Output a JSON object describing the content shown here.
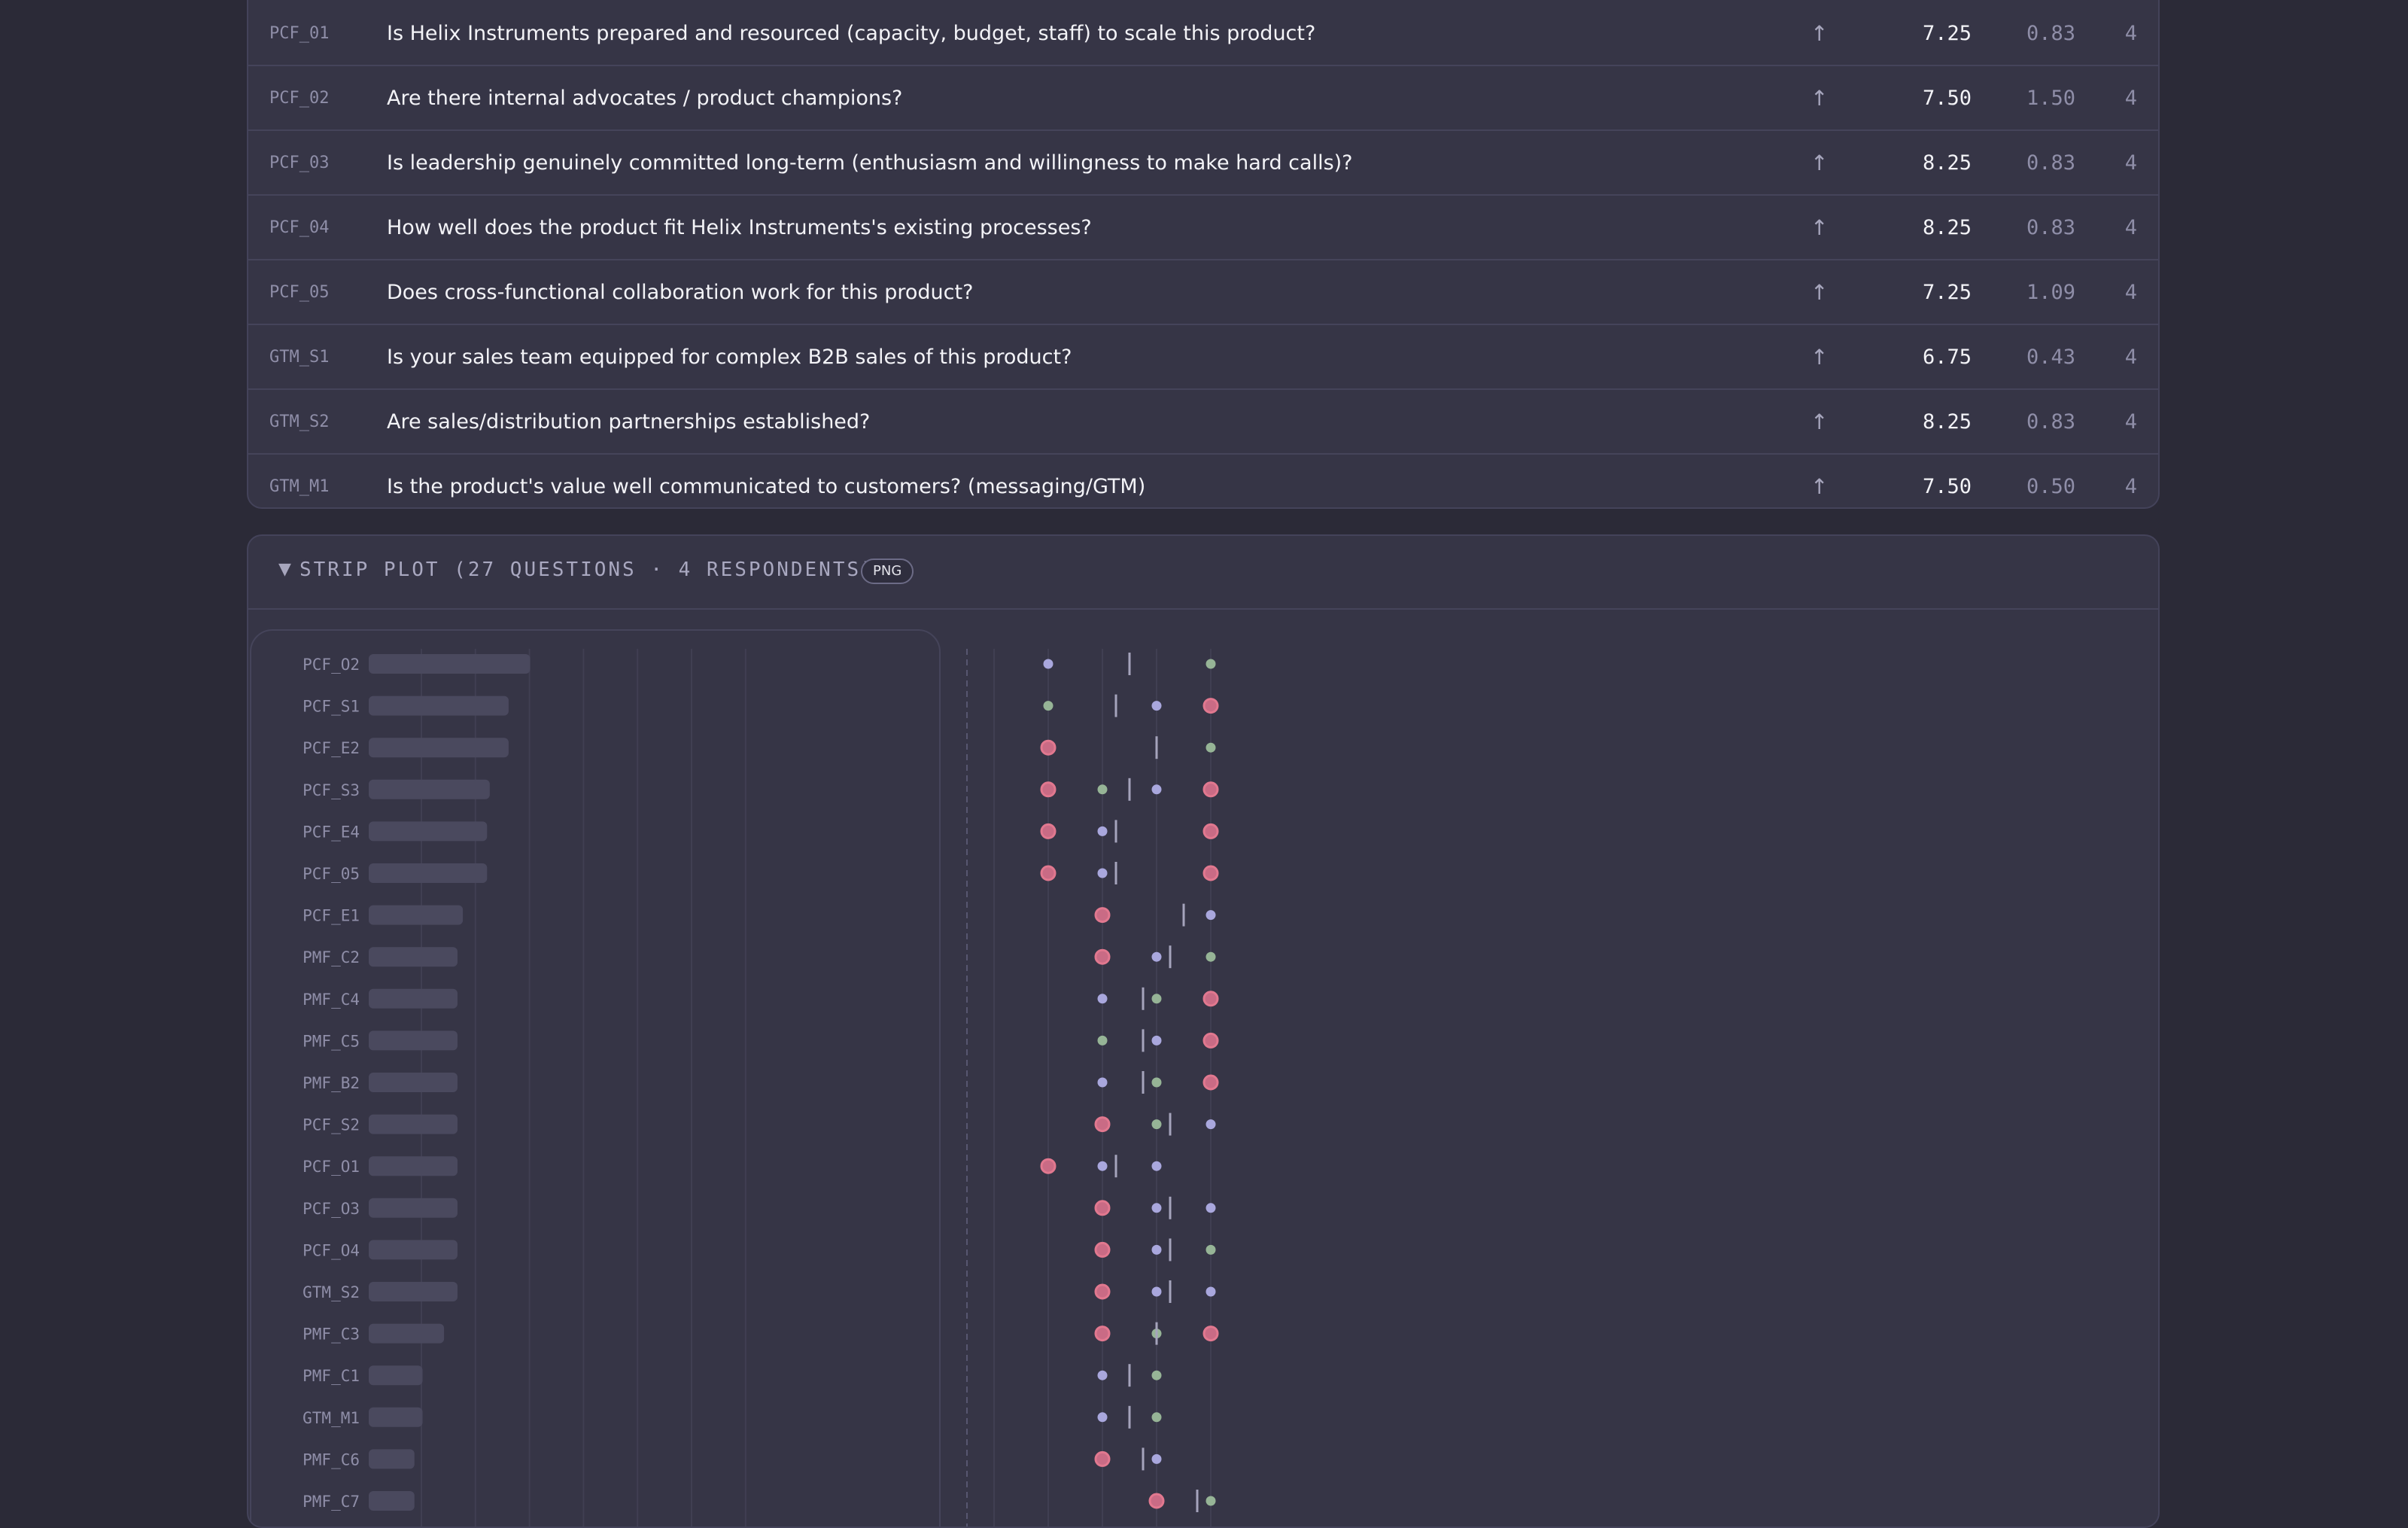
{
  "questions_table": {
    "rows": [
      {
        "id": "PCF_01",
        "text": "Is Helix Instruments prepared and resourced (capacity, budget, staff) to scale this product?",
        "direction": "↑",
        "mean": "7.25",
        "sd": "0.83",
        "n": "4"
      },
      {
        "id": "PCF_02",
        "text": "Are there internal advocates / product champions?",
        "direction": "↑",
        "mean": "7.50",
        "sd": "1.50",
        "n": "4"
      },
      {
        "id": "PCF_03",
        "text": "Is leadership genuinely committed long-term (enthusiasm and willingness to make hard calls)?",
        "direction": "↑",
        "mean": "8.25",
        "sd": "0.83",
        "n": "4"
      },
      {
        "id": "PCF_04",
        "text": "How well does the product fit Helix Instruments's existing processes?",
        "direction": "↑",
        "mean": "8.25",
        "sd": "0.83",
        "n": "4"
      },
      {
        "id": "PCF_05",
        "text": "Does cross-functional collaboration work for this product?",
        "direction": "↑",
        "mean": "7.25",
        "sd": "1.09",
        "n": "4"
      },
      {
        "id": "GTM_S1",
        "text": "Is your sales team equipped for complex B2B sales of this product?",
        "direction": "↑",
        "mean": "6.75",
        "sd": "0.43",
        "n": "4"
      },
      {
        "id": "GTM_S2",
        "text": "Are sales/distribution partnerships established?",
        "direction": "↑",
        "mean": "8.25",
        "sd": "0.83",
        "n": "4"
      },
      {
        "id": "GTM_M1",
        "text": "Is the product's value well communicated to customers? (messaging/GTM)",
        "direction": "↑",
        "mean": "7.50",
        "sd": "0.50",
        "n": "4"
      }
    ]
  },
  "strip_plot": {
    "toggle_icon": "triangle-down-icon",
    "title": "STRIP PLOT (27 QUESTIONS · 4 RESPONDENTS)",
    "png_button": "PNG"
  },
  "colors": {
    "lavender": "#a9a7dd",
    "green": "#96b496",
    "pink_fill": "#c96b85",
    "pink_ring": "#e1788f",
    "bar": "#4a495e",
    "mean_tick": "#a5a4bc"
  },
  "chart_data": {
    "type": "scatter",
    "x_range": [
      1,
      10
    ],
    "rows": [
      {
        "label": "PCF_O2",
        "spread": 3.0,
        "mean": 7.5,
        "points": [
          {
            "v": 6,
            "c": "lavender"
          },
          {
            "v": 9,
            "c": "green"
          }
        ]
      },
      {
        "label": "PCF_S1",
        "spread": 2.6,
        "mean": 7.25,
        "points": [
          {
            "v": 6,
            "c": "green"
          },
          {
            "v": 8,
            "c": "lavender"
          },
          {
            "v": 9,
            "c": "pink"
          }
        ]
      },
      {
        "label": "PCF_E2",
        "spread": 2.6,
        "mean": 8.0,
        "points": [
          {
            "v": 6,
            "c": "pink"
          },
          {
            "v": 9,
            "c": "green"
          }
        ]
      },
      {
        "label": "PCF_S3",
        "spread": 2.25,
        "mean": 7.5,
        "points": [
          {
            "v": 6,
            "c": "pink"
          },
          {
            "v": 7,
            "c": "green"
          },
          {
            "v": 8,
            "c": "lavender"
          },
          {
            "v": 9,
            "c": "pink"
          }
        ]
      },
      {
        "label": "PCF_E4",
        "spread": 2.2,
        "mean": 7.25,
        "points": [
          {
            "v": 6,
            "c": "pink"
          },
          {
            "v": 7,
            "c": "lavender"
          },
          {
            "v": 9,
            "c": "pink"
          }
        ]
      },
      {
        "label": "PCF_05",
        "spread": 2.2,
        "mean": 7.25,
        "points": [
          {
            "v": 6,
            "c": "pink"
          },
          {
            "v": 7,
            "c": "lavender"
          },
          {
            "v": 9,
            "c": "pink"
          }
        ]
      },
      {
        "label": "PCF_E1",
        "spread": 1.75,
        "mean": 8.5,
        "points": [
          {
            "v": 7,
            "c": "pink"
          },
          {
            "v": 9,
            "c": "lavender"
          }
        ]
      },
      {
        "label": "PMF_C2",
        "spread": 1.65,
        "mean": 8.25,
        "points": [
          {
            "v": 7,
            "c": "pink"
          },
          {
            "v": 8,
            "c": "lavender"
          },
          {
            "v": 9,
            "c": "green"
          }
        ]
      },
      {
        "label": "PMF_C4",
        "spread": 1.65,
        "mean": 7.75,
        "points": [
          {
            "v": 7,
            "c": "lavender"
          },
          {
            "v": 8,
            "c": "green"
          },
          {
            "v": 9,
            "c": "pink"
          }
        ]
      },
      {
        "label": "PMF_C5",
        "spread": 1.65,
        "mean": 7.75,
        "points": [
          {
            "v": 7,
            "c": "green"
          },
          {
            "v": 8,
            "c": "lavender"
          },
          {
            "v": 9,
            "c": "pink"
          }
        ]
      },
      {
        "label": "PMF_B2",
        "spread": 1.65,
        "mean": 7.75,
        "points": [
          {
            "v": 7,
            "c": "lavender"
          },
          {
            "v": 8,
            "c": "green"
          },
          {
            "v": 9,
            "c": "pink"
          }
        ]
      },
      {
        "label": "PCF_S2",
        "spread": 1.65,
        "mean": 8.25,
        "points": [
          {
            "v": 7,
            "c": "pink"
          },
          {
            "v": 8,
            "c": "green"
          },
          {
            "v": 9,
            "c": "lavender"
          }
        ]
      },
      {
        "label": "PCF_O1",
        "spread": 1.65,
        "mean": 7.25,
        "points": [
          {
            "v": 6,
            "c": "pink"
          },
          {
            "v": 7,
            "c": "lavender"
          },
          {
            "v": 8,
            "c": "lavender"
          }
        ]
      },
      {
        "label": "PCF_O3",
        "spread": 1.65,
        "mean": 8.25,
        "points": [
          {
            "v": 7,
            "c": "pink"
          },
          {
            "v": 8,
            "c": "lavender"
          },
          {
            "v": 9,
            "c": "lavender"
          }
        ]
      },
      {
        "label": "PCF_O4",
        "spread": 1.65,
        "mean": 8.25,
        "points": [
          {
            "v": 7,
            "c": "pink"
          },
          {
            "v": 8,
            "c": "lavender"
          },
          {
            "v": 9,
            "c": "green"
          }
        ]
      },
      {
        "label": "GTM_S2",
        "spread": 1.65,
        "mean": 8.25,
        "points": [
          {
            "v": 7,
            "c": "pink"
          },
          {
            "v": 8,
            "c": "lavender"
          },
          {
            "v": 9,
            "c": "lavender"
          }
        ]
      },
      {
        "label": "PMF_C3",
        "spread": 1.4,
        "mean": 8.0,
        "points": [
          {
            "v": 7,
            "c": "pink"
          },
          {
            "v": 8,
            "c": "green"
          },
          {
            "v": 9,
            "c": "pink"
          }
        ]
      },
      {
        "label": "PMF_C1",
        "spread": 1.0,
        "mean": 7.5,
        "points": [
          {
            "v": 7,
            "c": "lavender"
          },
          {
            "v": 8,
            "c": "green"
          }
        ]
      },
      {
        "label": "GTM_M1",
        "spread": 1.0,
        "mean": 7.5,
        "points": [
          {
            "v": 7,
            "c": "lavender"
          },
          {
            "v": 8,
            "c": "green"
          }
        ]
      },
      {
        "label": "PMF_C6",
        "spread": 0.85,
        "mean": 7.75,
        "points": [
          {
            "v": 7,
            "c": "pink"
          },
          {
            "v": 8,
            "c": "lavender"
          }
        ]
      },
      {
        "label": "PMF_C7",
        "spread": 0.85,
        "mean": 8.75,
        "points": [
          {
            "v": 8,
            "c": "pink"
          },
          {
            "v": 9,
            "c": "green"
          }
        ]
      }
    ]
  }
}
